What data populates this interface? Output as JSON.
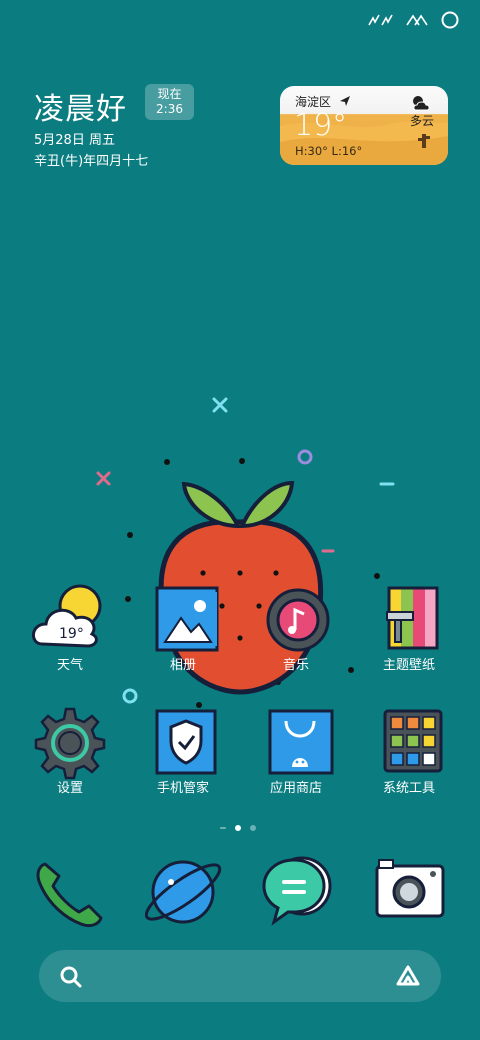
{
  "status_bar": {
    "icons": [
      "signal-icon",
      "wifi-icon",
      "battery-ring-icon"
    ]
  },
  "greeting": {
    "text": "凌晨好",
    "time_label": "现在",
    "time_value": "2:36",
    "date_line1": "5月28日 周五",
    "date_line2": "辛丑(牛)年四月十七"
  },
  "weather_widget": {
    "location": "海淀区",
    "temperature": "19°",
    "high_low": "H:30° L:16°",
    "condition": "多云"
  },
  "apps_row1": [
    {
      "label": "天气",
      "icon": "weather-icon",
      "badge": "19°"
    },
    {
      "label": "相册",
      "icon": "gallery-icon"
    },
    {
      "label": "音乐",
      "icon": "music-icon"
    },
    {
      "label": "主题壁纸",
      "icon": "theme-wallpaper-icon"
    }
  ],
  "apps_row2": [
    {
      "label": "设置",
      "icon": "settings-gear-icon"
    },
    {
      "label": "手机管家",
      "icon": "phone-manager-shield-icon"
    },
    {
      "label": "应用商店",
      "icon": "app-store-bag-icon"
    },
    {
      "label": "系统工具",
      "icon": "system-tools-icon"
    }
  ],
  "page_indicator": {
    "count": 3,
    "active": 1
  },
  "dock": [
    "phone-icon",
    "browser-icon",
    "messages-icon",
    "camera-icon"
  ],
  "colors": {
    "background": "#0b7d80",
    "accent_blue": "#2f9be8",
    "accent_red": "#e44b2f"
  }
}
